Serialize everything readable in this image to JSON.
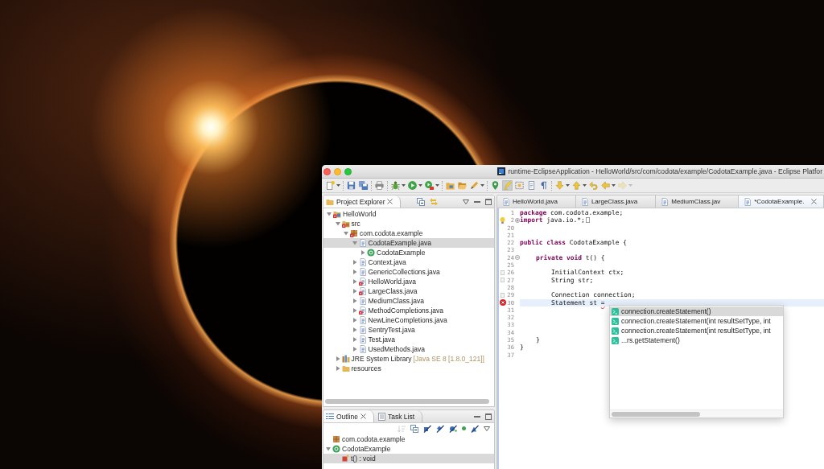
{
  "window": {
    "title": "runtime-EclipseApplication - HelloWorld/src/com/codota/example/CodotaExample.java - Eclipse Platfor"
  },
  "toolbar": [
    [
      {
        "kind": "new",
        "menu": true,
        "pressed": false,
        "disabled": false
      }
    ],
    [
      {
        "kind": "save",
        "menu": false,
        "pressed": false,
        "disabled": false
      },
      {
        "kind": "saveall",
        "menu": false,
        "pressed": false,
        "disabled": false
      }
    ],
    [
      {
        "kind": "print",
        "menu": false,
        "pressed": false,
        "disabled": false
      }
    ],
    [
      {
        "kind": "debug",
        "menu": true,
        "pressed": false,
        "disabled": false
      },
      {
        "kind": "run",
        "menu": true,
        "pressed": false,
        "disabled": false
      },
      {
        "kind": "tools",
        "menu": true,
        "pressed": false,
        "disabled": false
      }
    ],
    [
      {
        "kind": "folder",
        "menu": false,
        "pressed": false,
        "disabled": false
      },
      {
        "kind": "openfolder",
        "menu": false,
        "pressed": false,
        "disabled": false
      },
      {
        "kind": "pencil",
        "menu": true,
        "pressed": false,
        "disabled": false
      }
    ],
    [
      {
        "kind": "pin",
        "menu": false,
        "pressed": false,
        "disabled": false
      },
      {
        "kind": "highlight",
        "menu": false,
        "pressed": true,
        "disabled": false
      },
      {
        "kind": "block",
        "menu": false,
        "pressed": false,
        "disabled": false
      },
      {
        "kind": "document",
        "menu": false,
        "pressed": false,
        "disabled": false
      },
      {
        "kind": "pilcrow",
        "menu": false,
        "pressed": false,
        "disabled": false
      }
    ],
    [
      {
        "kind": "down",
        "menu": true,
        "pressed": false,
        "disabled": false
      },
      {
        "kind": "up",
        "menu": true,
        "pressed": false,
        "disabled": false
      },
      {
        "kind": "undo",
        "menu": false,
        "pressed": false,
        "disabled": false
      },
      {
        "kind": "back",
        "menu": true,
        "pressed": false,
        "disabled": false
      },
      {
        "kind": "forward",
        "menu": true,
        "pressed": false,
        "disabled": true
      }
    ]
  ],
  "project_explorer": {
    "title": "Project Explorer",
    "tree": [
      {
        "label": "HelloWorld",
        "kind": "project",
        "expanded": true,
        "selected": false,
        "error": true,
        "children": [
          {
            "label": "src",
            "kind": "source",
            "expanded": true,
            "selected": false,
            "error": true,
            "children": [
              {
                "label": "com.codota.example",
                "kind": "package",
                "expanded": true,
                "selected": false,
                "error": true,
                "children": [
                  {
                    "label": "CodotaExample.java",
                    "kind": "java",
                    "expanded": true,
                    "selected": true,
                    "error": false,
                    "children": [
                      {
                        "label": "CodotaExample",
                        "kind": "class",
                        "expanded": false,
                        "selected": false,
                        "error": false
                      }
                    ]
                  },
                  {
                    "label": "Context.java",
                    "kind": "java",
                    "expanded": false,
                    "selected": false,
                    "error": false
                  },
                  {
                    "label": "GenericCollections.java",
                    "kind": "java",
                    "expanded": false,
                    "selected": false,
                    "error": false
                  },
                  {
                    "label": "HelloWorld.java",
                    "kind": "java",
                    "expanded": false,
                    "selected": false,
                    "error": true
                  },
                  {
                    "label": "LargeClass.java",
                    "kind": "java",
                    "expanded": false,
                    "selected": false,
                    "error": true
                  },
                  {
                    "label": "MediumClass.java",
                    "kind": "java",
                    "expanded": false,
                    "selected": false,
                    "error": false
                  },
                  {
                    "label": "MethodCompletions.java",
                    "kind": "java",
                    "expanded": false,
                    "selected": false,
                    "error": true
                  },
                  {
                    "label": "NewLineCompletions.java",
                    "kind": "java",
                    "expanded": false,
                    "selected": false,
                    "error": false
                  },
                  {
                    "label": "SentryTest.java",
                    "kind": "java",
                    "expanded": false,
                    "selected": false,
                    "error": false
                  },
                  {
                    "label": "Test.java",
                    "kind": "java",
                    "expanded": false,
                    "selected": false,
                    "error": false
                  },
                  {
                    "label": "UsedMethods.java",
                    "kind": "java",
                    "expanded": false,
                    "selected": false,
                    "error": false
                  }
                ]
              }
            ]
          },
          {
            "label": "JRE System Library",
            "qualifier": "[Java SE 8 [1.8.0_121]]",
            "kind": "library",
            "expanded": false,
            "selected": false,
            "error": false
          },
          {
            "label": "resources",
            "kind": "folder",
            "expanded": false,
            "selected": false,
            "error": false
          }
        ]
      }
    ]
  },
  "outline": {
    "tabs": [
      {
        "label": "Outline",
        "kind": "outline",
        "selected": true
      },
      {
        "label": "Task List",
        "kind": "tasks",
        "selected": false
      }
    ],
    "toolbar": [
      {
        "kind": "sort",
        "disabled": true
      },
      {
        "kind": "collapse",
        "disabled": false
      },
      {
        "kind": "fields",
        "disabled": false
      },
      {
        "kind": "static",
        "disabled": false
      },
      {
        "kind": "nonpublic",
        "disabled": false
      },
      {
        "kind": "dot",
        "disabled": false
      },
      {
        "kind": "local",
        "disabled": false
      },
      {
        "kind": "menu",
        "disabled": false
      }
    ],
    "tree": [
      {
        "label": "com.codota.example",
        "kind": "package",
        "selected": false
      },
      {
        "label": "CodotaExample",
        "kind": "class",
        "expanded": true,
        "selected": false,
        "children": [
          {
            "label": "t() : void",
            "kind": "method",
            "selected": true
          }
        ]
      }
    ]
  },
  "editor": {
    "tabs": [
      {
        "label": "HelloWorld.java",
        "selected": false
      },
      {
        "label": "LargeClass.java",
        "selected": false
      },
      {
        "label": "MediumClass.jav",
        "selected": false
      },
      {
        "label": "*CodotaExample.",
        "selected": true
      }
    ],
    "lines": [
      {
        "number": "1",
        "code": "**package** com.codota.example;",
        "current": false
      },
      {
        "number": "2",
        "code": "**import** java.io.*;",
        "fold": {
          "expanded": false
        },
        "marker": {
          "kind": "warning"
        },
        "current": false
      },
      {
        "number": "20",
        "current": false
      },
      {
        "number": "21",
        "current": false
      },
      {
        "number": "22",
        "code": "**public** **class** CodotaExample {",
        "current": false
      },
      {
        "number": "23",
        "current": false
      },
      {
        "number": "24",
        "code": "    **private** **void** t() {",
        "fold": {
          "expanded": true
        },
        "current": false
      },
      {
        "number": "25",
        "current": false
      },
      {
        "number": "26",
        "code": "        InitialContext ctx;",
        "marker": {
          "kind": "note"
        },
        "current": false
      },
      {
        "number": "27",
        "code": "        String str;",
        "marker": {
          "kind": "note"
        },
        "current": false
      },
      {
        "number": "28",
        "current": false
      },
      {
        "number": "29",
        "code": "        Connection connection;",
        "marker": {
          "kind": "note"
        },
        "current": false
      },
      {
        "number": "30",
        "code": "        Statement st ",
        "flagged": "=",
        "marker": {
          "kind": "error"
        },
        "current": true
      },
      {
        "number": "31",
        "current": false
      },
      {
        "number": "32",
        "current": false
      },
      {
        "number": "33",
        "current": false
      },
      {
        "number": "34",
        "current": false
      },
      {
        "number": "35",
        "code": "    }",
        "current": false
      },
      {
        "number": "36",
        "code": "}",
        "current": false
      },
      {
        "number": "37",
        "current": false
      }
    ],
    "completion": {
      "items": [
        {
          "label": "connection.createStatement()",
          "selected": true
        },
        {
          "label": "connection.createStatement(int resultSetType, int",
          "selected": false
        },
        {
          "label": "connection.createStatement(int resultSetType, int",
          "selected": false
        },
        {
          "label": "...rs.getStatement()",
          "selected": false
        }
      ]
    }
  }
}
